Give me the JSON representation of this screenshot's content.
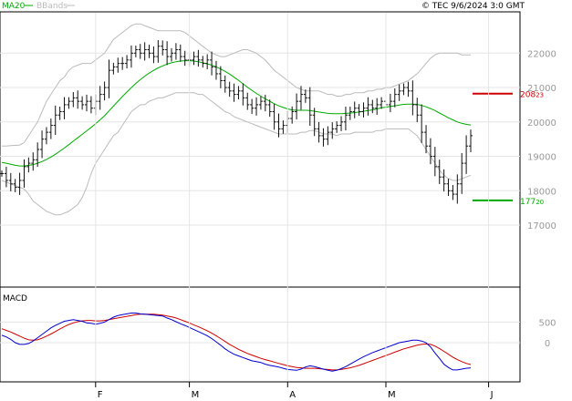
{
  "header": {
    "legend_ma": "MA20",
    "legend_bb": "BBands",
    "source": "© TEC 9/6/2024 3:0 GMT"
  },
  "colors": {
    "ma": "#00aa00",
    "bb": "#bbbbbb",
    "price": "#111111",
    "macd": "#0000cc",
    "signal": "#cc0000",
    "resistance": "#cc0000",
    "support": "#00aa00",
    "grid": "#e5e5e5"
  },
  "chart_data": [
    {
      "type": "line",
      "subtype": "ohlc-bars",
      "title": "",
      "ylim": [
        15200,
        23200
      ],
      "y_ticks": [
        17000,
        18000,
        19000,
        20000,
        21000,
        22000
      ],
      "y_tick_labels": [
        "17000",
        "18000",
        "19000",
        "20000",
        "21000",
        "22000"
      ],
      "x_month_labels": [
        {
          "label": "F",
          "index": 21
        },
        {
          "label": "M",
          "index": 42
        },
        {
          "label": "A",
          "index": 64
        },
        {
          "label": "M",
          "index": 86
        },
        {
          "label": "J",
          "index": 109
        }
      ],
      "closes": [
        18500,
        18300,
        18200,
        18100,
        18300,
        18700,
        18800,
        18900,
        19200,
        19500,
        19700,
        19900,
        20200,
        20300,
        20500,
        20600,
        20700,
        20600,
        20500,
        20600,
        20400,
        20600,
        20800,
        21000,
        21500,
        21600,
        21700,
        21700,
        21800,
        22000,
        22100,
        22000,
        22100,
        22000,
        21900,
        22200,
        22100,
        21900,
        22000,
        22100,
        21900,
        21800,
        21800,
        21900,
        21800,
        21700,
        21800,
        21600,
        21400,
        21200,
        21000,
        20900,
        20800,
        20900,
        20700,
        20500,
        20400,
        20500,
        20600,
        20500,
        20300,
        20000,
        19800,
        19900,
        20100,
        20300,
        20600,
        20800,
        20700,
        20200,
        19800,
        19600,
        19500,
        19700,
        19800,
        19900,
        20000,
        20200,
        20300,
        20400,
        20300,
        20400,
        20500,
        20400,
        20500,
        20600,
        20500,
        20600,
        20800,
        20900,
        21000,
        20900,
        20500,
        20200,
        19700,
        19300,
        19000,
        18700,
        18400,
        18200,
        18000,
        17900,
        18200,
        18800,
        19300,
        19600
      ],
      "series": [
        {
          "name": "MA20",
          "values": [
            18820,
            18800,
            18770,
            18740,
            18720,
            18720,
            18740,
            18760,
            18800,
            18850,
            18910,
            18980,
            19060,
            19150,
            19240,
            19340,
            19440,
            19540,
            19640,
            19740,
            19840,
            19950,
            20060,
            20180,
            20320,
            20460,
            20600,
            20740,
            20870,
            21000,
            21120,
            21230,
            21330,
            21420,
            21500,
            21570,
            21630,
            21680,
            21720,
            21750,
            21770,
            21780,
            21780,
            21770,
            21750,
            21720,
            21690,
            21650,
            21600,
            21540,
            21470,
            21390,
            21300,
            21210,
            21110,
            21010,
            20920,
            20830,
            20750,
            20670,
            20600,
            20530,
            20470,
            20420,
            20380,
            20350,
            20340,
            20340,
            20340,
            20330,
            20310,
            20290,
            20270,
            20250,
            20240,
            20240,
            20240,
            20250,
            20260,
            20270,
            20290,
            20310,
            20330,
            20350,
            20380,
            20410,
            20430,
            20450,
            20470,
            20490,
            20510,
            20520,
            20520,
            20510,
            20480,
            20440,
            20390,
            20330,
            20260,
            20190,
            20120,
            20060,
            20000,
            19960,
            19930,
            19910
          ]
        },
        {
          "name": "BBands-upper",
          "values": [
            19300,
            19300,
            19310,
            19320,
            19330,
            19400,
            19600,
            19800,
            20000,
            20300,
            20600,
            20800,
            21000,
            21200,
            21300,
            21500,
            21600,
            21650,
            21700,
            21700,
            21700,
            21800,
            21900,
            22000,
            22200,
            22400,
            22500,
            22600,
            22700,
            22800,
            22850,
            22850,
            22800,
            22750,
            22700,
            22650,
            22650,
            22650,
            22650,
            22650,
            22650,
            22600,
            22500,
            22400,
            22300,
            22200,
            22100,
            22000,
            21950,
            21900,
            21900,
            21950,
            22000,
            22050,
            22100,
            22100,
            22050,
            22000,
            21900,
            21800,
            21650,
            21500,
            21400,
            21300,
            21200,
            21100,
            21000,
            20950,
            20900,
            20900,
            20900,
            20900,
            20850,
            20800,
            20800,
            20750,
            20750,
            20800,
            20800,
            20850,
            20850,
            20850,
            20900,
            20900,
            20950,
            20950,
            21000,
            21000,
            21050,
            21100,
            21150,
            21200,
            21300,
            21400,
            21550,
            21700,
            21850,
            21950,
            22000,
            22000,
            22000,
            22000,
            22000,
            21950,
            21950,
            21950
          ]
        },
        {
          "name": "BBands-lower",
          "values": [
            18300,
            18250,
            18200,
            18150,
            18100,
            18050,
            17900,
            17700,
            17600,
            17500,
            17400,
            17350,
            17300,
            17300,
            17350,
            17400,
            17500,
            17600,
            17800,
            18100,
            18500,
            18800,
            19000,
            19200,
            19400,
            19600,
            19700,
            19900,
            20100,
            20300,
            20400,
            20500,
            20500,
            20600,
            20650,
            20700,
            20700,
            20750,
            20800,
            20850,
            20850,
            20850,
            20850,
            20850,
            20800,
            20800,
            20700,
            20600,
            20500,
            20400,
            20300,
            20250,
            20150,
            20100,
            20050,
            20000,
            19950,
            19900,
            19850,
            19800,
            19750,
            19700,
            19650,
            19650,
            19650,
            19650,
            19650,
            19700,
            19700,
            19750,
            19750,
            19700,
            19650,
            19650,
            19650,
            19600,
            19650,
            19650,
            19650,
            19700,
            19700,
            19700,
            19700,
            19700,
            19750,
            19750,
            19800,
            19800,
            19800,
            19800,
            19800,
            19800,
            19700,
            19600,
            19400,
            19200,
            19000,
            18800,
            18600,
            18450,
            18350,
            18300,
            18300,
            18350,
            18400,
            18450
          ]
        }
      ],
      "levels": [
        {
          "name": "resistance",
          "value": 20823,
          "label": "208",
          "label_small": "23"
        },
        {
          "name": "support",
          "value": 17720,
          "label": "177",
          "label_small": "20"
        }
      ]
    },
    {
      "type": "line",
      "title": "MACD",
      "ylim": [
        -950,
        1350
      ],
      "y_ticks": [
        0,
        500
      ],
      "y_tick_labels": [
        "0",
        "500"
      ],
      "series": [
        {
          "name": "MACD",
          "values": [
            180,
            140,
            80,
            0,
            -40,
            -40,
            -20,
            40,
            120,
            200,
            280,
            360,
            420,
            470,
            520,
            540,
            560,
            540,
            520,
            480,
            470,
            450,
            470,
            500,
            560,
            620,
            660,
            680,
            700,
            720,
            720,
            700,
            690,
            680,
            670,
            660,
            650,
            600,
            560,
            510,
            460,
            420,
            370,
            320,
            270,
            220,
            170,
            100,
            20,
            -60,
            -150,
            -220,
            -280,
            -320,
            -360,
            -400,
            -440,
            -460,
            -480,
            -520,
            -550,
            -570,
            -590,
            -620,
            -650,
            -660,
            -670,
            -640,
            -590,
            -560,
            -580,
            -610,
            -640,
            -670,
            -690,
            -670,
            -630,
            -580,
            -520,
            -460,
            -400,
            -340,
            -290,
            -240,
            -200,
            -160,
            -120,
            -80,
            -40,
            0,
            20,
            40,
            60,
            60,
            40,
            0,
            -100,
            -250,
            -380,
            -520,
            -600,
            -660,
            -660,
            -640,
            -620,
            -610
          ]
        },
        {
          "name": "Signal",
          "values": [
            340,
            300,
            260,
            210,
            160,
            110,
            70,
            60,
            70,
            110,
            160,
            210,
            270,
            330,
            390,
            440,
            480,
            510,
            530,
            540,
            540,
            530,
            530,
            540,
            560,
            580,
            600,
            620,
            640,
            660,
            680,
            690,
            690,
            690,
            690,
            680,
            670,
            650,
            630,
            600,
            560,
            520,
            480,
            430,
            390,
            340,
            290,
            230,
            170,
            100,
            30,
            -40,
            -100,
            -160,
            -210,
            -260,
            -300,
            -340,
            -380,
            -410,
            -440,
            -470,
            -500,
            -530,
            -560,
            -580,
            -600,
            -610,
            -620,
            -620,
            -620,
            -630,
            -640,
            -650,
            -660,
            -660,
            -650,
            -630,
            -610,
            -580,
            -550,
            -510,
            -470,
            -430,
            -390,
            -350,
            -310,
            -270,
            -230,
            -190,
            -150,
            -120,
            -90,
            -60,
            -40,
            -30,
            -40,
            -80,
            -140,
            -210,
            -280,
            -350,
            -410,
            -460,
            -500,
            -530
          ]
        }
      ]
    }
  ]
}
